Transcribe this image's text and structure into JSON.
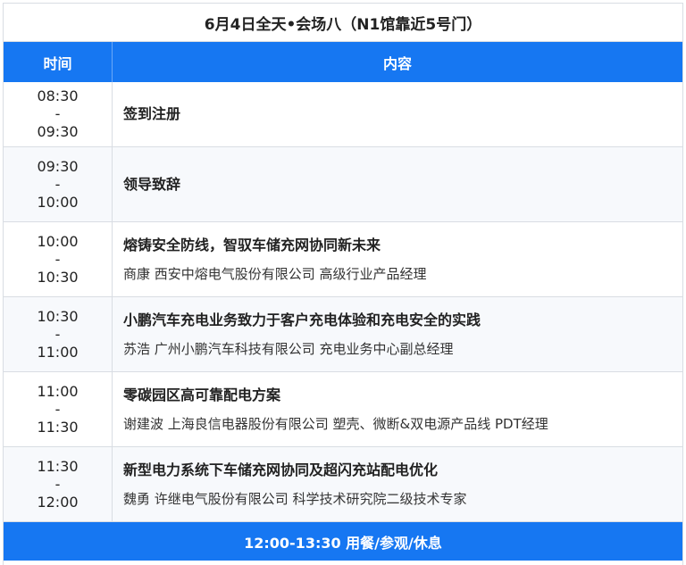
{
  "title": "6月4日全天•会场八（N1馆靠近5号门）",
  "header": {
    "time": "时间",
    "content": "内容"
  },
  "rows": [
    {
      "start": "08:30",
      "sep": "-",
      "end": "09:30",
      "title": "签到注册",
      "speaker": ""
    },
    {
      "start": "09:30",
      "sep": "-",
      "end": "10:00",
      "title": "领导致辞",
      "speaker": ""
    },
    {
      "start": "10:00",
      "sep": "-",
      "end": "10:30",
      "title": "熔铸安全防线，智驭车储充网协同新未来",
      "speaker": "商康 西安中熔电气股份有限公司 高级行业产品经理"
    },
    {
      "start": "10:30",
      "sep": "-",
      "end": "11:00",
      "title": "小鹏汽车充电业务致力于客户充电体验和充电安全的实践",
      "speaker": "苏浩 广州小鹏汽车科技有限公司 充电业务中心副总经理"
    },
    {
      "start": "11:00",
      "sep": "-",
      "end": "11:30",
      "title": "零碳园区高可靠配电方案",
      "speaker": "谢建波 上海良信电器股份有限公司 塑壳、微断&双电源产品线 PDT经理"
    },
    {
      "start": "11:30",
      "sep": "-",
      "end": "12:00",
      "title": "新型电力系统下车储充网协同及超闪充站配电优化",
      "speaker": "魏勇 许继电气股份有限公司 科学技术研究院二级技术专家"
    }
  ],
  "break": "12:00-13:30 用餐/参观/休息"
}
